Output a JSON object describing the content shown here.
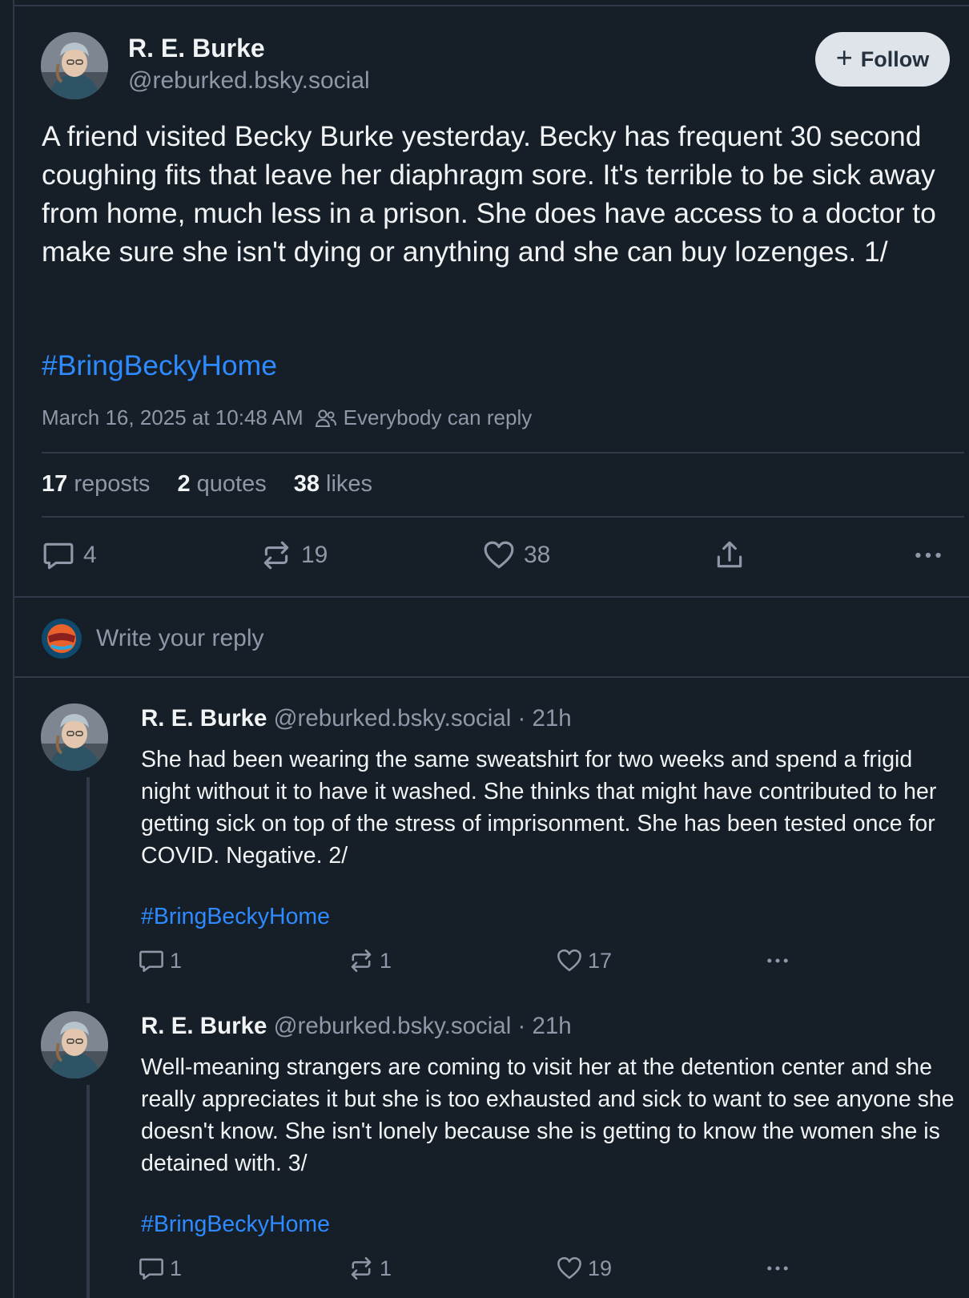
{
  "main_post": {
    "author_name": "R. E. Burke",
    "author_handle": "@reburked.bsky.social",
    "follow_label": "Follow",
    "text": "A friend visited Becky Burke yesterday. Becky has frequent 30 second coughing fits that leave her diaphragm sore. It's terrible to be sick away from home, much less in a prison. She does have access to a doctor to make sure she isn't dying or anything and she can buy lozenges. 1/",
    "hashtag": "#BringBeckyHome",
    "timestamp": "March 16, 2025 at 10:48 AM",
    "reply_setting": "Everybody can reply",
    "stats": {
      "reposts_count": "17",
      "reposts_label": "reposts",
      "quotes_count": "2",
      "quotes_label": "quotes",
      "likes_count": "38",
      "likes_label": "likes"
    },
    "actions": {
      "replies": "4",
      "reposts": "19",
      "likes": "38"
    }
  },
  "reply_composer": {
    "placeholder": "Write your reply"
  },
  "replies": [
    {
      "author_name": "R. E. Burke",
      "author_handle": "@reburked.bsky.social",
      "time": "· 21h",
      "text": "She had been wearing the same sweatshirt for two weeks and spend a frigid night without it to have it washed. She thinks that might have contributed to her getting sick on top of the stress of imprisonment. She has been tested once for COVID. Negative. 2/",
      "hashtag": "#BringBeckyHome",
      "replies": "1",
      "reposts": "1",
      "likes": "17"
    },
    {
      "author_name": "R. E. Burke",
      "author_handle": "@reburked.bsky.social",
      "time": "· 21h",
      "text": "Well-meaning strangers are coming to visit her at the detention center and she really appreciates it but she is too exhausted and sick to want to see anyone she doesn't know. She isn't lonely because she is getting to know the women she is detained with. 3/",
      "hashtag": "#BringBeckyHome",
      "replies": "1",
      "reposts": "1",
      "likes": "19"
    }
  ],
  "colors": {
    "background": "#161e27",
    "link": "#2e8bff",
    "muted": "#8d99a8",
    "border": "#2e3a48"
  }
}
